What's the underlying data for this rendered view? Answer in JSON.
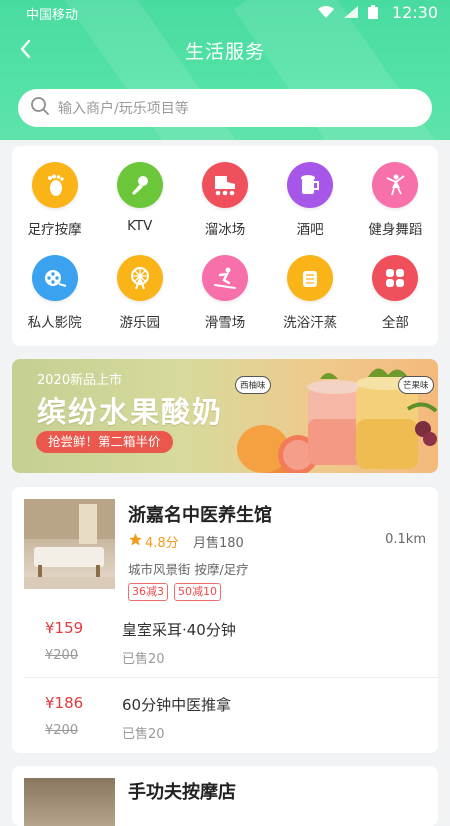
{
  "status_bar": {
    "carrier": "中国移动",
    "time": "12:30"
  },
  "nav": {
    "title": "生活服务"
  },
  "search": {
    "placeholder": "输入商户/玩乐项目等"
  },
  "categories": [
    {
      "label": "足疗按摩",
      "icon": "foot-icon",
      "color": "#fbb417"
    },
    {
      "label": "KTV",
      "icon": "microphone-icon",
      "color": "#6cc63a"
    },
    {
      "label": "溜冰场",
      "icon": "skate-icon",
      "color": "#f0505c"
    },
    {
      "label": "酒吧",
      "icon": "beer-icon",
      "color": "#a657e7"
    },
    {
      "label": "健身舞蹈",
      "icon": "dance-icon",
      "color": "#f770a9"
    },
    {
      "label": "私人影院",
      "icon": "film-reel-icon",
      "color": "#3aa2ef"
    },
    {
      "label": "游乐园",
      "icon": "ferris-wheel-icon",
      "color": "#fbb417"
    },
    {
      "label": "滑雪场",
      "icon": "ski-icon",
      "color": "#f770a9"
    },
    {
      "label": "洗浴汗蒸",
      "icon": "bath-icon",
      "color": "#fbb417"
    },
    {
      "label": "全部",
      "icon": "grid-icon",
      "color": "#f0505c"
    }
  ],
  "banner": {
    "tag": "2020新品上市",
    "headline": "缤纷水果酸奶",
    "promo": "抢尝鲜！第二箱半价",
    "bubble_left": "西柚味",
    "bubble_right": "芒果味"
  },
  "shops": [
    {
      "name": "浙嘉名中医养生馆",
      "rating": "4.8分",
      "sold": "月售180",
      "distance": "0.1km",
      "address": "城市风景街  按摩/足疗",
      "badges": [
        "36减3",
        "50减10"
      ],
      "deals": [
        {
          "price": "¥159",
          "original": "¥200",
          "title": "皇室采耳·40分钟",
          "sold": "已售20"
        },
        {
          "price": "¥186",
          "original": "¥200",
          "title": "60分钟中医推拿",
          "sold": "已售20"
        }
      ]
    },
    {
      "name": "手功夫按摩店"
    }
  ],
  "colors": {
    "theme_green": "#4cdfa2",
    "price_red": "#e33b3b",
    "star": "#f29b1d"
  }
}
